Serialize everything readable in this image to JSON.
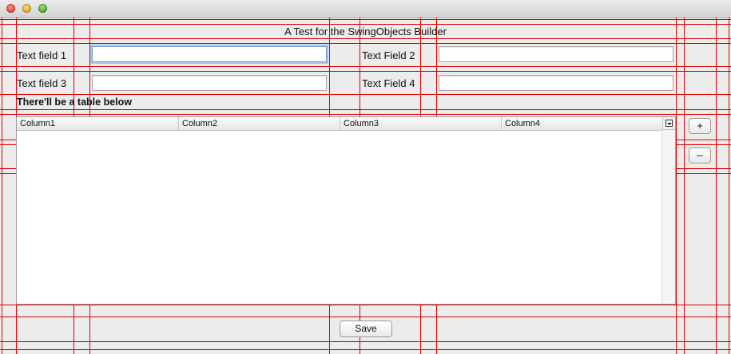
{
  "window": {
    "controls": [
      "close",
      "minimize",
      "maximize"
    ]
  },
  "form": {
    "title": "A Test for the SwingObjects Builder",
    "fields": [
      {
        "label": "Text field 1",
        "value": "",
        "focused": true
      },
      {
        "label": "Text Field 2",
        "value": ""
      },
      {
        "label": "Text field 3",
        "value": ""
      },
      {
        "label": "Text Field 4",
        "value": ""
      }
    ],
    "table_caption": "There'll be a table below"
  },
  "table": {
    "columns": [
      "Column1",
      "Column2",
      "Column3",
      "Column4"
    ],
    "rows": []
  },
  "buttons": {
    "add_label": "+",
    "remove_label": "–",
    "save_label": "Save"
  },
  "colors": {
    "layout_guides": "#e00000",
    "focus_ring": "#6e9ed6"
  }
}
